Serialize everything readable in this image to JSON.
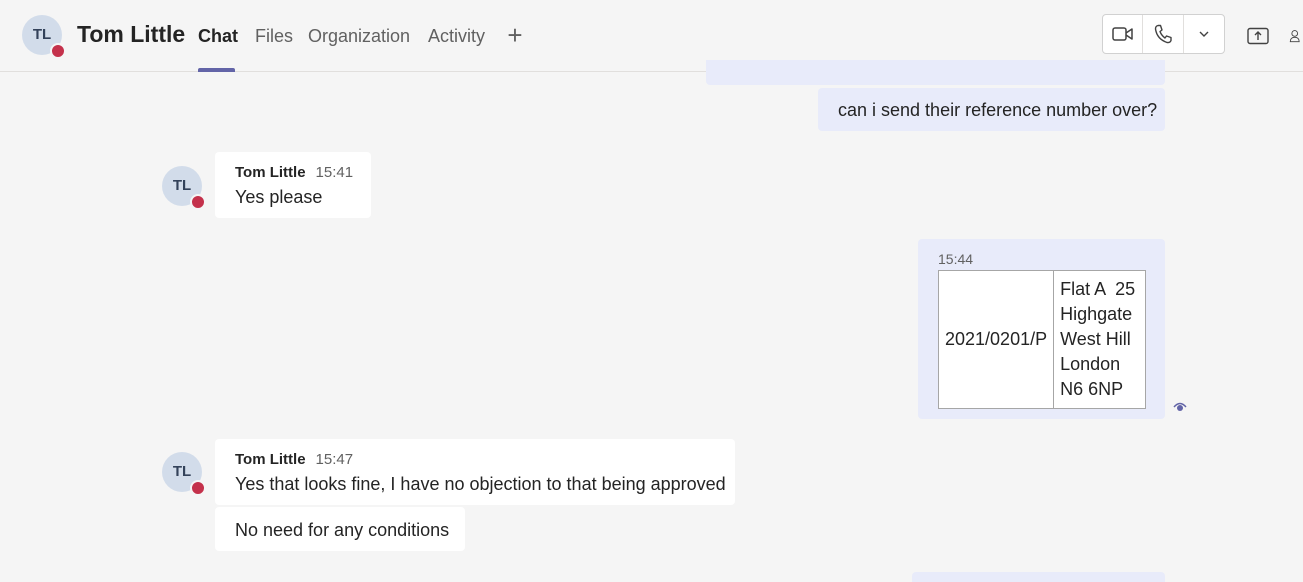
{
  "header": {
    "avatar_initials": "TL",
    "contact_name": "Tom Little",
    "tabs": [
      {
        "label": "Chat"
      },
      {
        "label": "Files"
      },
      {
        "label": "Organization"
      },
      {
        "label": "Activity"
      }
    ],
    "add_tab_icon": "+",
    "status_color": "#c4314b",
    "accent_color": "#6264a7"
  },
  "messages": {
    "out1_partial": "...",
    "out2": "can i send their reference number over?",
    "in1": {
      "avatar": "TL",
      "author": "Tom Little",
      "time": "15:41",
      "text": "Yes please"
    },
    "out3": {
      "time": "15:44",
      "ref": "2021/0201/P",
      "address_lines": [
        "Flat A  25",
        "Highgate",
        "West Hill",
        "London",
        "N6 6NP"
      ]
    },
    "in2": {
      "avatar": "TL",
      "author": "Tom Little",
      "time": "15:47",
      "text": "Yes that looks fine, I have no objection to that being approved",
      "followup": "No need for any conditions"
    }
  }
}
